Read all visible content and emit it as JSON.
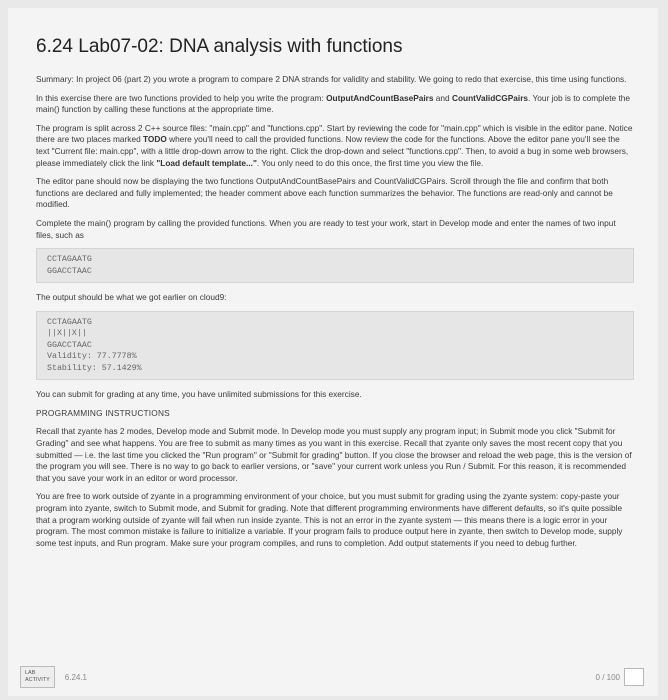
{
  "title": "6.24 Lab07-02: DNA analysis with functions",
  "p1": "Summary: In project 06 (part 2) you wrote a program to compare 2 DNA strands for validity and stability. We going to redo that exercise, this time using functions.",
  "p2_a": "In this exercise there are two functions provided to help you write the program: ",
  "p2_b": "OutputAndCountBasePairs",
  "p2_c": " and ",
  "p2_d": "CountValidCGPairs",
  "p2_e": ". Your job is to complete the main() function by calling these functions at the appropriate time.",
  "p3_a": "The program is split across 2 C++ source files: \"main.cpp\" and \"functions.cpp\". Start by reviewing the code for \"main.cpp\" which is visible in the editor pane. Notice there are two places marked ",
  "p3_b": "TODO",
  "p3_c": " where you'll need to call the provided functions. Now review the code for the functions. Above the editor pane you'll see the text \"Current file: main.cpp\", with a little drop-down arrow to the right. Click the drop-down and select \"functions.cpp\". Then, to avoid a bug in some web browsers, please immediately click the link ",
  "p3_d": "\"Load default template...\"",
  "p3_e": ". You only need to do this once, the first time you view the file.",
  "p4": "The editor pane should now be displaying the two functions OutputAndCountBasePairs and CountValidCGPairs. Scroll through the file and confirm that both functions are declared and fully implemented; the header comment above each function summarizes the behavior. The functions are read-only and cannot be modified.",
  "p5": "Complete the main() program by calling the provided functions. When you are ready to test your work, start in Develop mode and enter the names of two input files, such as",
  "code1": [
    "CCTAGAATG",
    "GGACCTAAC"
  ],
  "p6": "The output should be what we got earlier on cloud9:",
  "code2": [
    "CCTAGAATG",
    "||X||X||",
    "GGACCTAAC",
    "Validity: 77.7778%",
    "Stability: 57.1429%"
  ],
  "p7": "You can submit for grading at any time, you have unlimited submissions for this exercise.",
  "heading": "PROGRAMMING INSTRUCTIONS",
  "p8": "Recall that zyante has 2 modes, Develop mode and Submit mode. In Develop mode you must supply any program input; in Submit mode you click \"Submit for Grading\" and see what happens. You are free to submit as many times as you want in this exercise. Recall that zyante only saves the most recent copy that you submitted — i.e. the last time you clicked the \"Run program\" or \"Submit for grading\" button. If you close the browser and reload the web page, this is the version of the program you will see. There is no way to go back to earlier versions, or \"save\" your current work unless you Run / Submit. For this reason, it is recommended that you save your work in an editor or word processor.",
  "p9": "You are free to work outside of zyante in a programming environment of your choice, but you must submit for grading using the zyante system: copy-paste your program into zyante, switch to Submit mode, and Submit for grading. Note that different programming environments have different defaults, so it's quite possible that a program working outside of zyante will fail when run inside zyante. This is not an error in the zyante system — this means there is a logic error in your program. The most common mistake is failure to initialize a variable. If your program fails to produce output here in zyante, then switch to Develop mode, supply some test inputs, and Run program. Make sure your program compiles, and runs to completion. Add output statements if you need to debug further.",
  "footer": {
    "badge_line1": "LAB",
    "badge_line2": "ACTIVITY",
    "lab_number": "6.24.1",
    "score": "0 / 100"
  }
}
